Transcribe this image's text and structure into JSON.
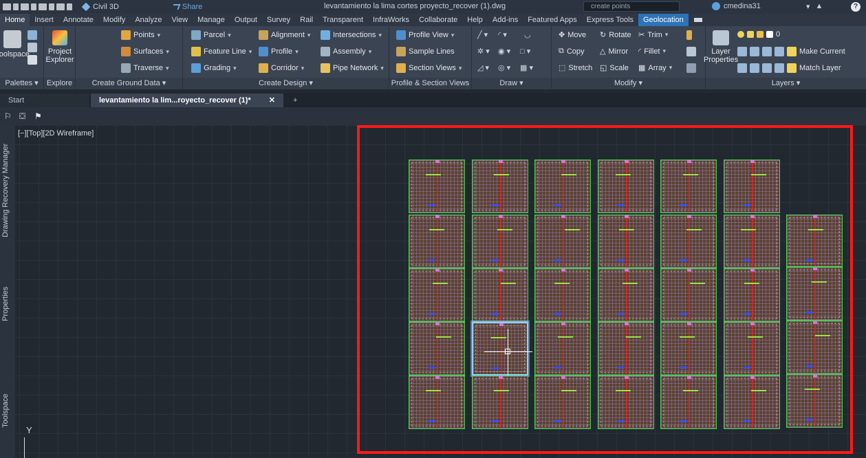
{
  "app": {
    "product": "Civil 3D",
    "share_label": "Share",
    "document_title": "levantamiento la lima cortes proyecto_recover (1).dwg",
    "search_placeholder": "create points",
    "username": "cmedina31"
  },
  "ribbon_tabs": [
    "Home",
    "Insert",
    "Annotate",
    "Modify",
    "Analyze",
    "View",
    "Manage",
    "Output",
    "Survey",
    "Rail",
    "Transparent",
    "InfraWorks",
    "Collaborate",
    "Help",
    "Add-ins",
    "Featured Apps",
    "Express Tools",
    "Geolocation"
  ],
  "active_tab": "Home",
  "ribbon": {
    "palettes": {
      "label": "Palettes",
      "toolspace": "Toolspace"
    },
    "explore": {
      "label": "Explore",
      "project_explorer": "Project Explorer"
    },
    "ground": {
      "label": "Create Ground Data",
      "points": "Points",
      "surfaces": "Surfaces",
      "traverse": "Traverse"
    },
    "design": {
      "label": "Create Design",
      "parcel": "Parcel",
      "feature_line": "Feature Line",
      "grading": "Grading",
      "alignment": "Alignment",
      "profile": "Profile",
      "corridor": "Corridor",
      "intersections": "Intersections",
      "assembly": "Assembly",
      "pipe_network": "Pipe Network"
    },
    "profile_section": {
      "label": "Profile & Section Views",
      "profile_view": "Profile View",
      "sample_lines": "Sample Lines",
      "section_views": "Section Views"
    },
    "draw": {
      "label": "Draw"
    },
    "modify": {
      "label": "Modify",
      "move": "Move",
      "copy": "Copy",
      "stretch": "Stretch",
      "rotate": "Rotate",
      "mirror": "Mirror",
      "scale": "Scale",
      "trim": "Trim",
      "fillet": "Fillet",
      "array": "Array"
    },
    "layers": {
      "label": "Layers",
      "layer_properties": "Layer Properties",
      "layer_value": "0",
      "make_current": "Make Current",
      "match_layer": "Match Layer"
    }
  },
  "doc_tabs": {
    "start": "Start",
    "active": "levantamiento la lim...royecto_recover (1)*"
  },
  "viewport": {
    "label": "[−][Top][2D Wireframe]",
    "ucs_axis": "Y"
  },
  "side_palettes": [
    "Drawing Recovery Manager",
    "Properties",
    "Toolspace"
  ],
  "colors": {
    "selection_box": "#ff1a1a",
    "sheet_border": "#45d24a",
    "geolocation_tab": "#2c73b8"
  }
}
